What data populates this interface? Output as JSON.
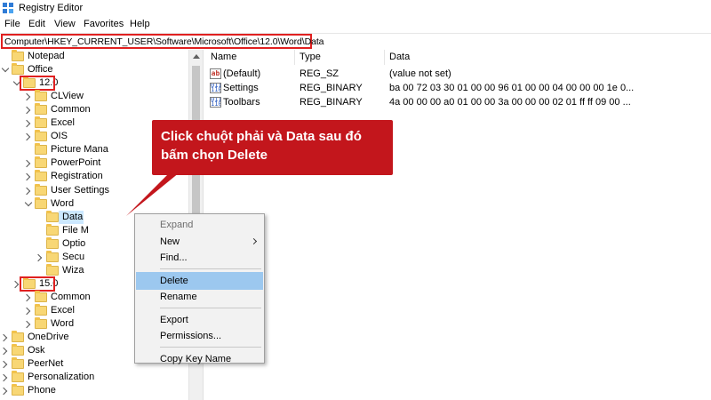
{
  "window": {
    "title": "Registry Editor"
  },
  "menu": [
    "File",
    "Edit",
    "View",
    "Favorites",
    "Help"
  ],
  "address": {
    "path": "Computer\\HKEY_CURRENT_USER\\Software\\Microsoft\\Office\\12.0\\Word\\Data"
  },
  "tree": {
    "items": [
      {
        "label": "Notepad",
        "expander": "none"
      },
      {
        "label": "Office",
        "expander": "expanded"
      },
      {
        "label": "12.0",
        "expander": "expanded",
        "highlighted": true
      },
      {
        "label": "CLView",
        "expander": "collapsed"
      },
      {
        "label": "Common",
        "expander": "collapsed"
      },
      {
        "label": "Excel",
        "expander": "collapsed"
      },
      {
        "label": "OIS",
        "expander": "collapsed"
      },
      {
        "label": "Picture Mana",
        "expander": "none"
      },
      {
        "label": "PowerPoint",
        "expander": "collapsed"
      },
      {
        "label": "Registration",
        "expander": "collapsed"
      },
      {
        "label": "User Settings",
        "expander": "collapsed"
      },
      {
        "label": "Word",
        "expander": "expanded"
      },
      {
        "label": "Data",
        "expander": "none",
        "selected": true
      },
      {
        "label": "File M",
        "expander": "none"
      },
      {
        "label": "Optio",
        "expander": "none"
      },
      {
        "label": "Secu",
        "expander": "collapsed"
      },
      {
        "label": "Wiza",
        "expander": "none"
      },
      {
        "label": "15.0",
        "expander": "collapsed",
        "highlighted": true
      },
      {
        "label": "Common",
        "expander": "collapsed"
      },
      {
        "label": "Excel",
        "expander": "collapsed"
      },
      {
        "label": "Word",
        "expander": "collapsed"
      },
      {
        "label": "OneDrive",
        "expander": "collapsed"
      },
      {
        "label": "Osk",
        "expander": "collapsed"
      },
      {
        "label": "PeerNet",
        "expander": "collapsed"
      },
      {
        "label": "Personalization",
        "expander": "collapsed"
      },
      {
        "label": "Phone",
        "expander": "collapsed"
      }
    ]
  },
  "list": {
    "columns": [
      "Name",
      "Type",
      "Data"
    ],
    "rows": [
      {
        "icon": "string-value-icon",
        "icon_text": "ab",
        "name": "(Default)",
        "type": "REG_SZ",
        "data": "(value not set)"
      },
      {
        "icon": "binary-value-icon",
        "icon_text": "011\n110",
        "name": "Settings",
        "type": "REG_BINARY",
        "data": "ba 00 72 03 30 01 00 00 96 01 00 00 04 00 00 00 1e 0..."
      },
      {
        "icon": "binary-value-icon",
        "icon_text": "011\n110",
        "name": "Toolbars",
        "type": "REG_BINARY",
        "data": "4a 00 00 00 a0 01 00 00 3a 00 00 00 02 01 ff ff 09 00 ..."
      }
    ]
  },
  "context_menu": {
    "items": [
      {
        "label": "Expand",
        "state": "disabled"
      },
      {
        "label": "New",
        "submenu": true
      },
      {
        "label": "Find..."
      },
      {
        "separator": true
      },
      {
        "label": "Delete",
        "state": "active"
      },
      {
        "label": "Rename"
      },
      {
        "separator": true
      },
      {
        "label": "Export"
      },
      {
        "label": "Permissions..."
      },
      {
        "separator": true
      },
      {
        "label": "Copy Key Name"
      }
    ]
  },
  "callout": {
    "line1": "Click chuột phải và Data sau đó",
    "line2": "bấm chọn Delete"
  },
  "colors": {
    "annotation_red": "#c3161c",
    "highlight_border": "#e02020",
    "menu_active": "#9cc8ef",
    "tree_selected": "#cce8ff",
    "folder": "#f8d775"
  }
}
